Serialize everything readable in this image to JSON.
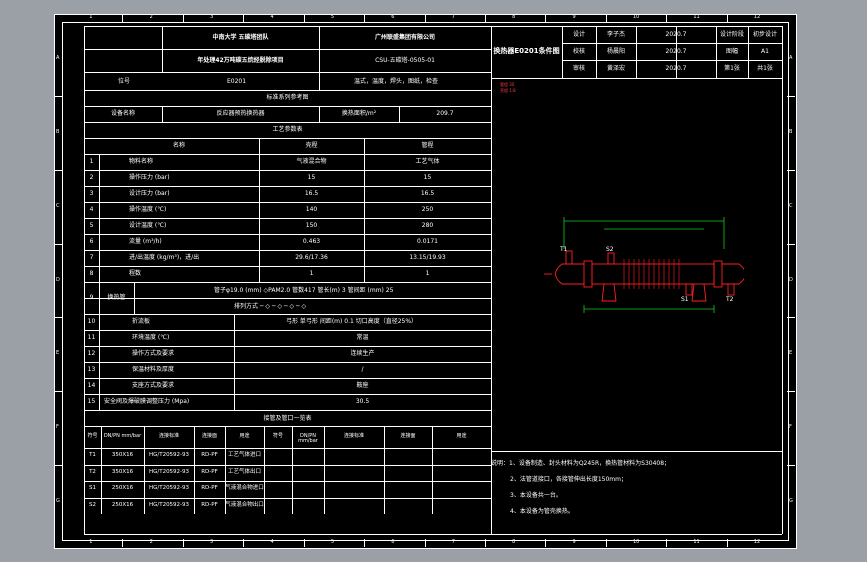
{
  "border": {
    "top_numbers": [
      "1",
      "2",
      "3",
      "4",
      "5",
      "6",
      "7",
      "8",
      "9",
      "10",
      "11",
      "12"
    ],
    "side_letters": [
      "A",
      "B",
      "C",
      "D",
      "E",
      "F",
      "G"
    ]
  },
  "title_block": {
    "org1": "中南大学 五碳塔团队",
    "org2": "广州联盛集团有限公司",
    "project": "年处理42万吨碳五烷烃脱除项目",
    "doc_no": "CSU-五碳塔-0505-01",
    "scope": "温式，温度，焊头，图纸，检查",
    "drawing_title": "换热器E0201条件图",
    "roles": [
      {
        "role": "设计",
        "name": "李子杰",
        "date": "2020.7"
      },
      {
        "role": "校核",
        "name": "杨晨阳",
        "date": "2020.7"
      },
      {
        "role": "审核",
        "name": "黄泽宏",
        "date": "2020.7"
      }
    ],
    "stage_label": "设计阶段",
    "stage_value": "初步设计",
    "size_label": "图幅",
    "size_value": "A1",
    "sheet_label": "第1张",
    "sheet_value": "共1张",
    "tag_label": "位号",
    "tag_value": "E0201"
  },
  "std_title": "标准系列参考图",
  "equipment": {
    "name_label": "设备名称",
    "name_value": "反应器预热换热器",
    "area_label": "换热面积/m²",
    "area_value": "209.7"
  },
  "process_title": "工艺参数表",
  "process_headers": [
    "名称",
    "壳程",
    "管程"
  ],
  "process_rows": [
    {
      "no": "1",
      "name": "物料名称",
      "shell": "气液混合物",
      "tube": "工艺气体"
    },
    {
      "no": "2",
      "name": "操作压力 (bar)",
      "shell": "15",
      "tube": "15"
    },
    {
      "no": "3",
      "name": "设计压力 (bar)",
      "shell": "16.5",
      "tube": "16.5"
    },
    {
      "no": "4",
      "name": "操作温度 (℃)",
      "shell": "140",
      "tube": "250"
    },
    {
      "no": "5",
      "name": "设计温度 (℃)",
      "shell": "150",
      "tube": "280"
    },
    {
      "no": "6",
      "name": "流量 (m³/h)",
      "shell": "0.463",
      "tube": "0.0171"
    },
    {
      "no": "7",
      "name": "进/出温度 (kg/m³)，进/出",
      "shell": "29.6/17.36",
      "tube": "13.15/19.93"
    },
    {
      "no": "8",
      "name": "程数",
      "shell": "1",
      "tube": "1"
    }
  ],
  "tube_spec": {
    "no": "9",
    "label": "换热管",
    "line1": "管子φ19.0 (mm)  ◇PAM2.0  管数417  管长(m) 3  管间距 (mm) 25",
    "line2": "排列方式 ─ ◇ ─ ◇ ─ ◇ ─ ◇"
  },
  "lower_rows": [
    {
      "no": "10",
      "name": "折流板",
      "value": "弓形  单弓形  间距(m) 0.1  切口高度（直径25%）"
    },
    {
      "no": "11",
      "name": "环境温度 (℃)",
      "value": "常温"
    },
    {
      "no": "12",
      "name": "操作方式及要求",
      "value": "连续生产"
    },
    {
      "no": "13",
      "name": "保温材料及厚度",
      "value": "/"
    },
    {
      "no": "14",
      "name": "支座方式及要求",
      "value": "鞍座"
    },
    {
      "no": "15",
      "name": "安全阀及爆破膜调整压力 (Mpa)",
      "value": "30.5"
    }
  ],
  "nozzle_title": "接管及管口一览表",
  "nozzle_headers": [
    "符号",
    "DN/PN mm/bar",
    "连接标准",
    "连接面",
    "用途",
    "符号",
    "DN/PN mm/bar",
    "连接标准",
    "连接面",
    "用途"
  ],
  "nozzles": [
    {
      "sym": "T1",
      "dn": "350X16",
      "std": "HG/T20592-93",
      "face": "RD-PF",
      "use": "工艺气体进口"
    },
    {
      "sym": "T2",
      "dn": "350X16",
      "std": "HG/T20592-93",
      "face": "RD-PF",
      "use": "工艺气体出口"
    },
    {
      "sym": "S1",
      "dn": "250X16",
      "std": "HG/T20592-93",
      "face": "RD-PF",
      "use": "气液混合物进口"
    },
    {
      "sym": "S2",
      "dn": "250X16",
      "std": "HG/T20592-93",
      "face": "RD-PF",
      "use": "气液混合物出口"
    }
  ],
  "notes": [
    "说明：1、设备制造、封头材料为Q245R，换热管材料为S30408；",
    "2、法管道接口，各接管伸出长度150mm；",
    "3、本设备共一台。",
    "4、本设备为管壳换热。"
  ],
  "drawing": {
    "label_t1": "T1",
    "label_s2": "S2",
    "label_s1": "S1",
    "label_t2": "T2",
    "tiny_legend_1": "管程 30",
    "tiny_legend_2": "壳程 1:8",
    "red": "#ff2020",
    "green": "#19c819"
  }
}
